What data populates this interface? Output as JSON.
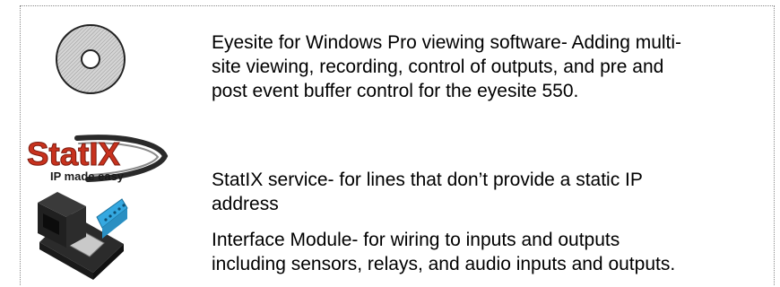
{
  "items": [
    {
      "icon": "cd-disc-icon",
      "lines": [
        "Eyesite for Windows Pro viewing software- Adding multi-",
        "site viewing, recording, control of outputs, and pre and",
        "post event buffer control for the eyesite 550."
      ]
    },
    {
      "icon": "statix-logo",
      "logo_text": "StatIX",
      "logo_tagline": "IP made easy",
      "lines": [
        "StatIX service- for lines that don’t provide a static IP",
        "address"
      ]
    },
    {
      "icon": "interface-module-icon",
      "lines": [
        "Interface Module- for wiring to inputs and outputs",
        "including sensors, relays, and audio inputs and outputs."
      ]
    }
  ],
  "colors": {
    "logo_red": "#c8321e",
    "terminal_blue": "#35a8e0",
    "border": "#8a8a8a"
  }
}
